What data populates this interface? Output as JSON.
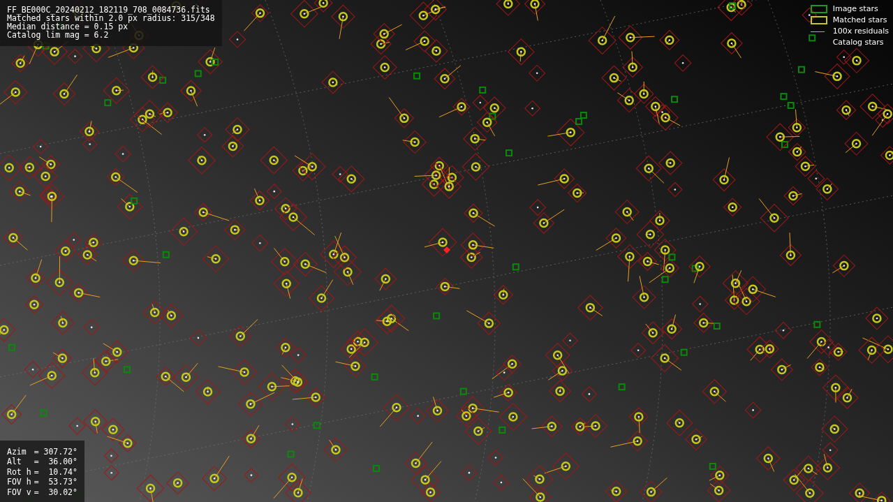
{
  "info_box": {
    "lines": [
      "FF_BE000C_20240212_182119_708_0084736.fits",
      "Matched stars within 2.0 px radius: 315/348",
      "Median distance = 0.15 px",
      "Catalog lim mag = 6.2"
    ]
  },
  "legend": [
    {
      "label": "Image stars",
      "kind": "green-box"
    },
    {
      "label": "Matched stars",
      "kind": "yellow-box"
    },
    {
      "label": "100x residuals",
      "kind": "line"
    },
    {
      "label": "Catalog stars",
      "kind": "none"
    }
  ],
  "pointing": [
    {
      "label": "Azim",
      "value": "= 307.72°"
    },
    {
      "label": "Alt",
      "value": "=  36.00°"
    },
    {
      "label": "Rot h",
      "value": "=  10.74°"
    },
    {
      "label": "FOV h",
      "value": "=  53.73°"
    },
    {
      "label": "FOV v",
      "value": "=  30.02°"
    }
  ]
}
